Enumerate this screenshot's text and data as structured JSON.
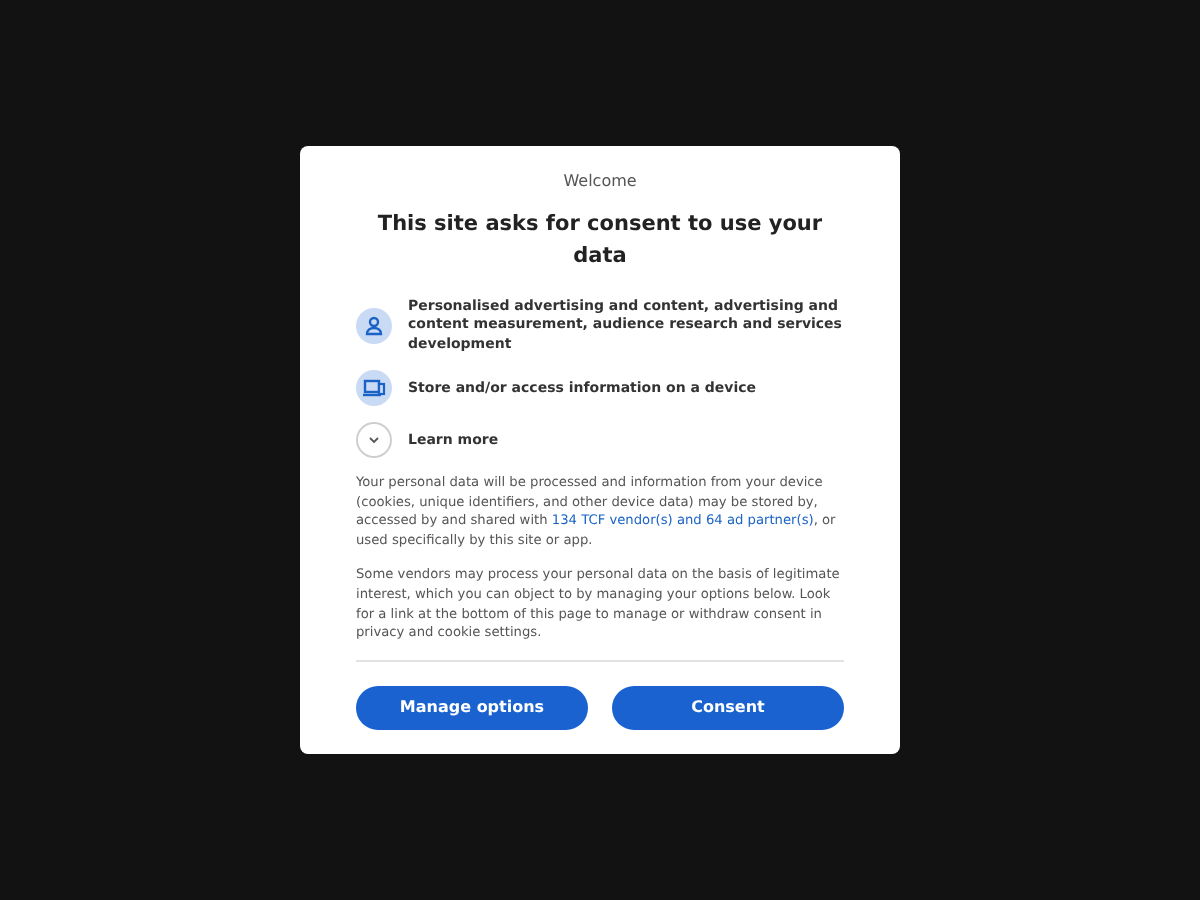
{
  "dialog": {
    "eyebrow": "Welcome",
    "title": "This site asks for consent to use your data",
    "purposes": [
      {
        "kind": "person",
        "text": "Personalised advertising and content, advertising and content measurement, audience research and services development"
      },
      {
        "kind": "device",
        "text": "Store and/or access information on a device"
      }
    ],
    "learn_more": {
      "label": "Learn more",
      "expanded": false
    },
    "paragraph_1": {
      "before": "Your personal data will be processed and information from your device (cookies, unique identifiers, and other device data) may be stored by, accessed by and shared with",
      "link": "134 TCF vendor(s) and 64 ad partner(s)",
      "after": ", or used specifically by this site or app."
    },
    "paragraph_2": "Some vendors may process your personal data on the basis of legitimate interest, which you can object to by managing your options below. Look for a link at the bottom of this page to manage or withdraw consent in privacy and cookie settings.",
    "buttons": [
      "Manage options",
      "Consent"
    ]
  }
}
